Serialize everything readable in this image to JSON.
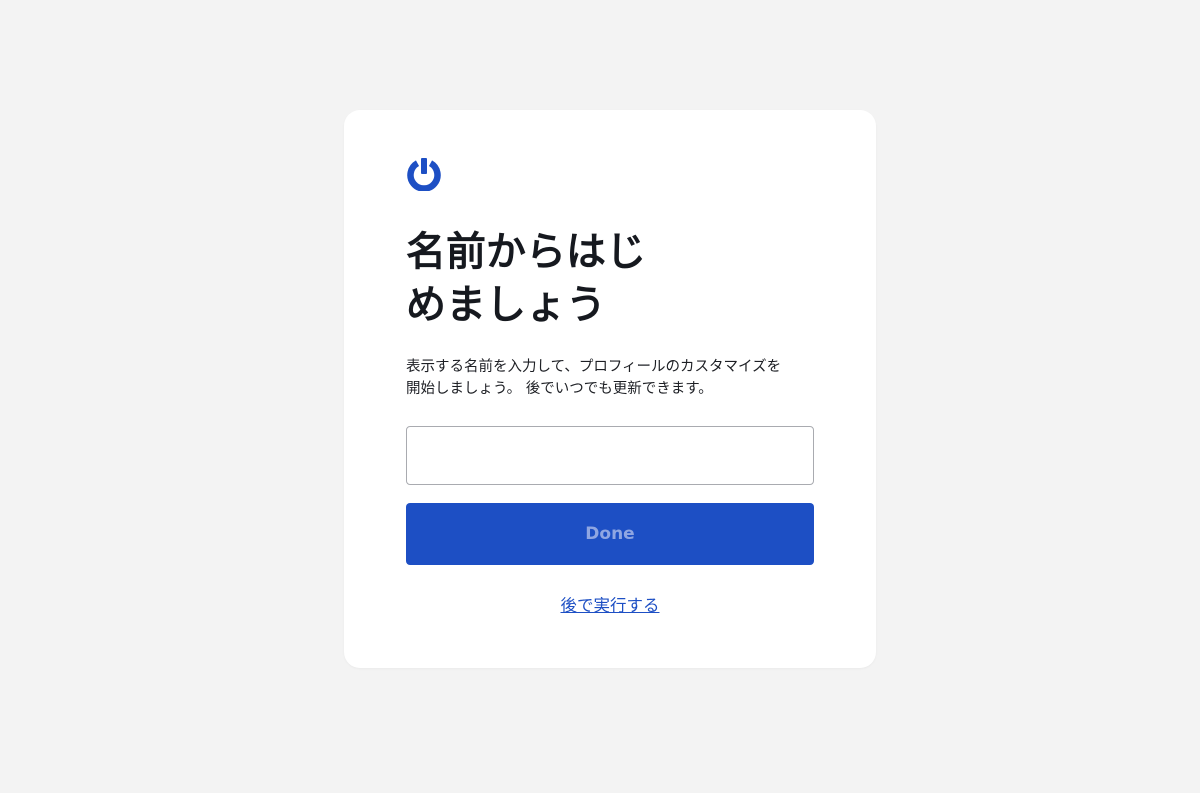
{
  "logo": {
    "icon": "power-icon",
    "color": "#1d4fc4"
  },
  "heading": {
    "line1": "名前からはじ",
    "line2": "めましょう"
  },
  "description": {
    "line1": "表示する名前を入力して、プロフィールのカスタマイズを",
    "line2": "開始しましょう。 後でいつでも更新できます。"
  },
  "name_input": {
    "value": "",
    "placeholder": ""
  },
  "done_button": {
    "label": "Done",
    "background": "#1d4fc4"
  },
  "later_link": {
    "label": "後で実行する"
  }
}
